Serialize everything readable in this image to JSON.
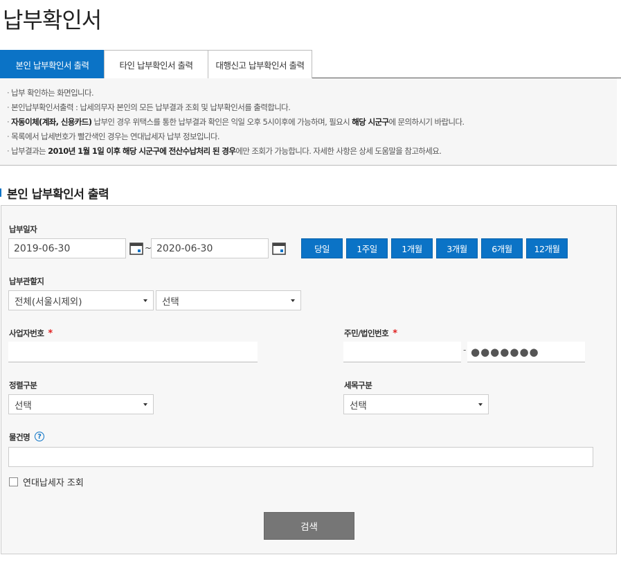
{
  "page": {
    "title": "납부확인서"
  },
  "tabs": [
    {
      "label": "본인 납부확인서 출력",
      "active": true
    },
    {
      "label": "타인 납부확인서 출력",
      "active": false
    },
    {
      "label": "대행신고 납부확인서 출력",
      "active": false
    }
  ],
  "notice": {
    "line1": "납부 확인하는 화면입니다.",
    "line2": "본인납부확인서출력 : 납세의무자 본인의 모든 납부결과 조회 및 납부확인서를 출력합니다.",
    "line3_bold1": "자동이체(계좌, 신용카드)",
    "line3_mid": " 납부인 경우 위택스를 통한 납부결과 확인은 익일 오후 5시이후에 가능하며, 필요시 ",
    "line3_bold2": "해당 시군구",
    "line3_end": "에 문의하시기 바랍니다.",
    "line4": "목록에서 납세번호가 빨간색인 경우는 연대납세자 납부 정보입니다.",
    "line5_start": "납부결과는 ",
    "line5_bold": "2010년 1월 1일 이후 해당 시군구에 전산수납처리 된 경우",
    "line5_end": "에만 조회가 가능합니다. 자세한 사항은 상세 도움말을 참고하세요."
  },
  "section": {
    "title": "본인 납부확인서 출력"
  },
  "form": {
    "payment_date": {
      "label": "납부일자",
      "start": "2019-06-30",
      "tilde": "~",
      "end": "2020-06-30",
      "periods": [
        "당일",
        "1주일",
        "1개월",
        "3개월",
        "6개월",
        "12개월"
      ]
    },
    "jurisdiction": {
      "label": "납부관할지",
      "select1": "전체(서울시제외)",
      "select2": "선택"
    },
    "business_number": {
      "label": "사업자번호",
      "required_mark": "*",
      "value": ""
    },
    "resident_number": {
      "label": "주민/법인번호",
      "required_mark": "*",
      "dash": "-",
      "masked": "●●●●●●●"
    },
    "sort": {
      "label": "정렬구분",
      "value": "선택"
    },
    "tax_item": {
      "label": "세목구분",
      "value": "선택"
    },
    "item_name": {
      "label": "물건명",
      "help": "?",
      "value": ""
    },
    "joint_taxpayer": {
      "label": "연대납세자 조회",
      "checked": false
    },
    "search_button": "검색"
  },
  "colors": {
    "accent": "#0b73c6",
    "required": "#e02020",
    "search_button": "#767676"
  }
}
